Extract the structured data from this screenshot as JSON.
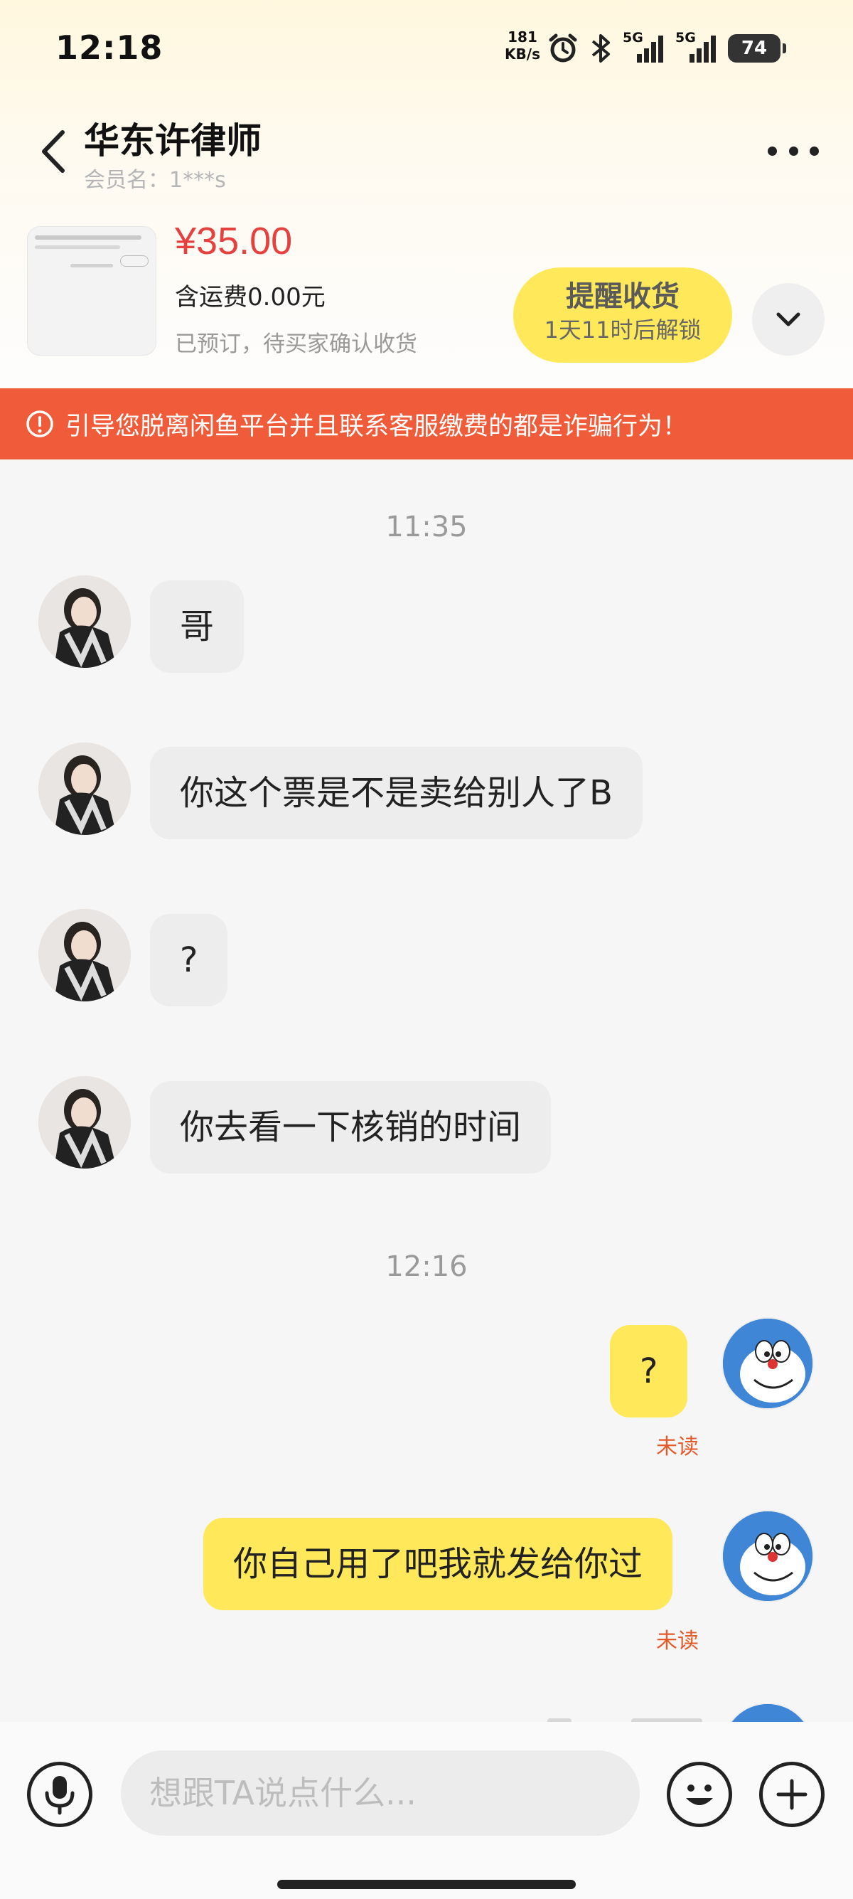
{
  "status_bar": {
    "time": "12:18",
    "net_speed_value": "181",
    "net_speed_unit": "KB/s",
    "signal1_label": "5G",
    "signal2_label": "5G",
    "battery_level": "74"
  },
  "header": {
    "title": "华东许律师",
    "subtitle": "会员名：1***s"
  },
  "product": {
    "price": "¥35.00",
    "shipping": "含运费0.00元",
    "status": "已预订，待买家确认收货",
    "remind_button_line1": "提醒收货",
    "remind_button_line2": "1天11时后解锁"
  },
  "warning": {
    "text": "引导您脱离闲鱼平台并且联系客服缴费的都是诈骗行为！"
  },
  "chat": {
    "time1": "11:35",
    "time2": "12:16",
    "messages": [
      {
        "side": "in",
        "text": "哥"
      },
      {
        "side": "in",
        "text": "你这个票是不是卖给别人了B"
      },
      {
        "side": "in",
        "text": "?"
      },
      {
        "side": "in",
        "text": "你去看一下核销的时间"
      },
      {
        "side": "out",
        "text": "?",
        "status": "未读"
      },
      {
        "side": "out",
        "text": "你自己用了吧我就发给你过",
        "status": "未读"
      }
    ]
  },
  "input": {
    "placeholder": "想跟TA说点什么..."
  },
  "colors": {
    "accent_yellow": "#ffe95a",
    "warning_orange": "#f05c3a",
    "price_red": "#e5413f",
    "unread_orange": "#e55a2b"
  }
}
